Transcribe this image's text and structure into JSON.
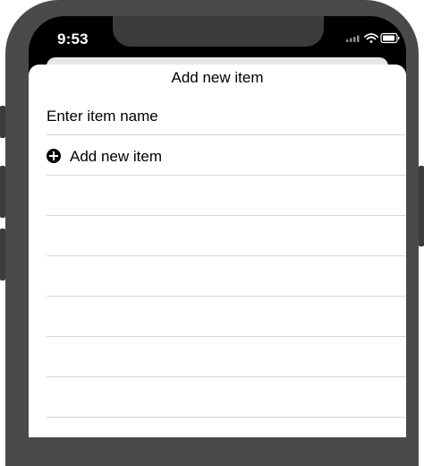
{
  "status_bar": {
    "time": "9:53",
    "icons": [
      "signal-icon",
      "wifi-icon",
      "battery-icon"
    ]
  },
  "sheet": {
    "title": "Add new item",
    "input_placeholder": "Enter item name",
    "add_button_label": "Add new item"
  }
}
